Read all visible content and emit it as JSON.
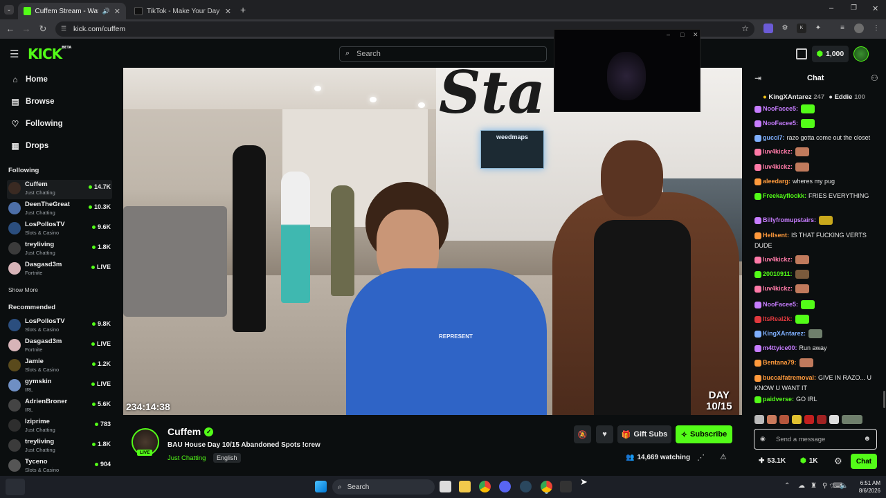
{
  "browser": {
    "tabs": [
      {
        "title": "Cuffem Stream - Watch Live",
        "active": true
      },
      {
        "title": "TikTok - Make Your Day",
        "active": false
      }
    ],
    "url": "kick.com/cuffem"
  },
  "header": {
    "logo": "KICK",
    "logo_beta": "BETA",
    "search_placeholder": "Search",
    "points": "1,000"
  },
  "sidebar": {
    "nav": [
      {
        "label": "Home",
        "icon": "home-icon"
      },
      {
        "label": "Browse",
        "icon": "compass-icon"
      },
      {
        "label": "Following",
        "icon": "heart-icon"
      },
      {
        "label": "Drops",
        "icon": "drops-icon"
      }
    ],
    "following_title": "Following",
    "following": [
      {
        "name": "Cuffem",
        "category": "Just Chatting",
        "viewers": "14.7K"
      },
      {
        "name": "DeenTheGreat",
        "category": "Just Chatting",
        "viewers": "10.3K"
      },
      {
        "name": "LosPollosTV",
        "category": "Slots & Casino",
        "viewers": "9.6K"
      },
      {
        "name": "treyliving",
        "category": "Just Chatting",
        "viewers": "1.8K"
      },
      {
        "name": "Dasgasd3m",
        "category": "Fortnite",
        "viewers": "LIVE"
      }
    ],
    "show_more": "Show More",
    "recommended_title": "Recommended",
    "recommended": [
      {
        "name": "LosPollosTV",
        "category": "Slots & Casino",
        "viewers": "9.8K"
      },
      {
        "name": "Dasgasd3m",
        "category": "Fortnite",
        "viewers": "LIVE"
      },
      {
        "name": "Jamie",
        "category": "Slots & Casino",
        "viewers": "1.2K"
      },
      {
        "name": "gymskin",
        "category": "IRL",
        "viewers": "LIVE"
      },
      {
        "name": "AdrienBroner",
        "category": "IRL",
        "viewers": "5.6K"
      },
      {
        "name": "lziprime",
        "category": "Just Chatting",
        "viewers": "783"
      },
      {
        "name": "treyliving",
        "category": "Just Chatting",
        "viewers": "1.8K"
      },
      {
        "name": "Tyceno",
        "category": "Slots & Casino",
        "viewers": "904"
      }
    ]
  },
  "video": {
    "uptime": "234:14:38",
    "overlay_day": "DAY",
    "overlay_count": "10/15",
    "sign": "weedmaps",
    "shirt": "REPRESENT"
  },
  "stream": {
    "channel": "Cuffem",
    "title": "BAU House Day 10/15 Abandoned Spots !crew",
    "category": "Just Chatting",
    "language": "English",
    "live_badge": "LIVE",
    "watching": "14,669 watching",
    "gift_label": "Gift Subs",
    "subscribe_label": "Subscribe"
  },
  "chat": {
    "title": "Chat",
    "pinned": [
      {
        "user": "KingXAntarez",
        "count": "247"
      },
      {
        "user": "Eddie",
        "count": "100"
      }
    ],
    "messages": [
      {
        "user": "NooFacee5:",
        "text": "",
        "color": "#c77dff"
      },
      {
        "user": "NooFacee5:",
        "text": "",
        "color": "#c77dff"
      },
      {
        "user": "gucci7:",
        "text": "razo gotta come out the closet",
        "color": "#7fb0ff"
      },
      {
        "user": "luv4kickz:",
        "text": "",
        "color": "#ff7aa8"
      },
      {
        "user": "luv4kickz:",
        "text": "",
        "color": "#ff7aa8"
      },
      {
        "user": "aleedarg:",
        "text": "wheres my pug",
        "color": "#ff9a3c"
      },
      {
        "user": "Freekayflockk:",
        "text": "FRIES EVERYTHING",
        "color": "#53fc18"
      },
      {
        "user": "Billyfromupstairs:",
        "text": "",
        "color": "#c77dff"
      },
      {
        "user": "Hellsent:",
        "text": "IS THAT FUCKING VERTS DUDE",
        "color": "#ff9a3c"
      },
      {
        "user": "luv4kickz:",
        "text": "",
        "color": "#ff7aa8"
      },
      {
        "user": "20010911:",
        "text": "",
        "color": "#53fc18"
      },
      {
        "user": "luv4kickz:",
        "text": "",
        "color": "#ff7aa8"
      },
      {
        "user": "NooFacee5:",
        "text": "",
        "color": "#c77dff"
      },
      {
        "user": "ItsReal2k:",
        "text": "",
        "color": "#e0393e"
      },
      {
        "user": "KingXAntarez:",
        "text": "",
        "color": "#7fb0ff"
      },
      {
        "user": "m4ttyice00:",
        "text": "Run away",
        "color": "#c77dff"
      },
      {
        "user": "Bentana79:",
        "text": "",
        "color": "#ff9a3c"
      },
      {
        "user": "buccalfatremoval:",
        "text": "GIVE IN RAZO... U KNOW U WANT IT",
        "color": "#ff9a3c"
      },
      {
        "user": "paidverse:",
        "text": "GO IRL",
        "color": "#53fc18"
      }
    ],
    "input_placeholder": "Send a message",
    "stat_followers": "53.1K",
    "stat_points": "1K",
    "chat_button": "Chat"
  },
  "taskbar": {
    "search": "Search",
    "time": "6:51 AM",
    "date": "8/6/2026"
  }
}
